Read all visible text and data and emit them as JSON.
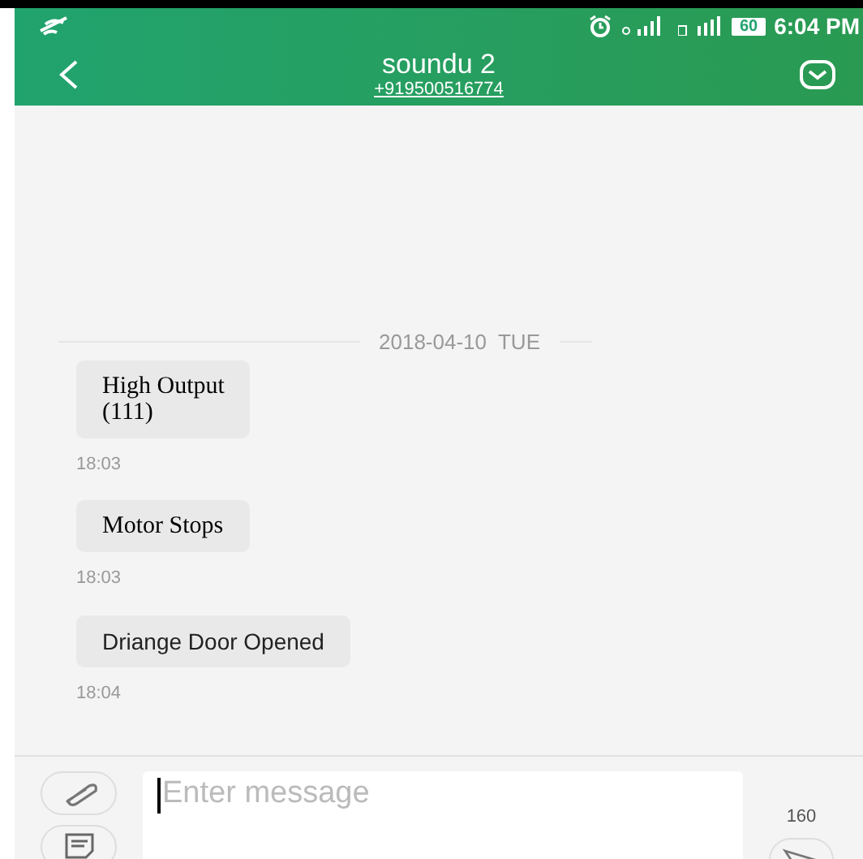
{
  "status_bar": {
    "battery": "60",
    "time": "6:04 PM"
  },
  "header": {
    "title": "soundu 2",
    "phone": "+919500516774"
  },
  "date_divider": "2018-04-10  TUE",
  "messages": [
    {
      "kind": "serif",
      "lines": [
        "High Output",
        "(111)"
      ],
      "time": "18:03"
    },
    {
      "kind": "serif",
      "lines": [
        "Motor Stops"
      ],
      "time": "18:03"
    },
    {
      "kind": "sans",
      "lines": [
        "Driange Door Opened"
      ],
      "time": "18:04"
    }
  ],
  "composer": {
    "placeholder": "Enter message",
    "counter": "160"
  }
}
